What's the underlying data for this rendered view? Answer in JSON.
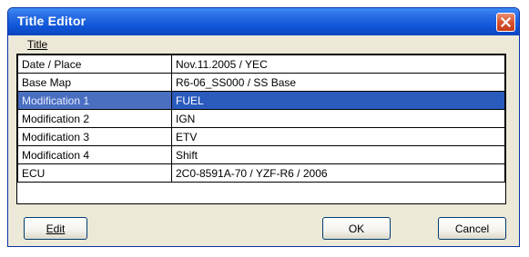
{
  "window": {
    "title": "Title Editor"
  },
  "menu": {
    "title": "Title"
  },
  "rows": [
    {
      "label": "Date / Place",
      "value": "Nov.11.2005 / YEC",
      "selected": false
    },
    {
      "label": "Base Map",
      "value": "R6-06_SS000 / SS Base",
      "selected": false
    },
    {
      "label": "Modification 1",
      "value": "FUEL",
      "selected": true
    },
    {
      "label": "Modification 2",
      "value": "IGN",
      "selected": false
    },
    {
      "label": "Modification 3",
      "value": "ETV",
      "selected": false
    },
    {
      "label": "Modification 4",
      "value": "Shift",
      "selected": false
    },
    {
      "label": "ECU",
      "value": "2C0-8591A-70 / YZF-R6 / 2006",
      "selected": false
    }
  ],
  "buttons": {
    "edit": "Edit",
    "ok": "OK",
    "cancel": "Cancel"
  },
  "colors": {
    "titlebar": "#0f54d6",
    "selection": "#2a5bbd",
    "close": "#d9532f"
  },
  "icons": {
    "close": "close-icon"
  }
}
